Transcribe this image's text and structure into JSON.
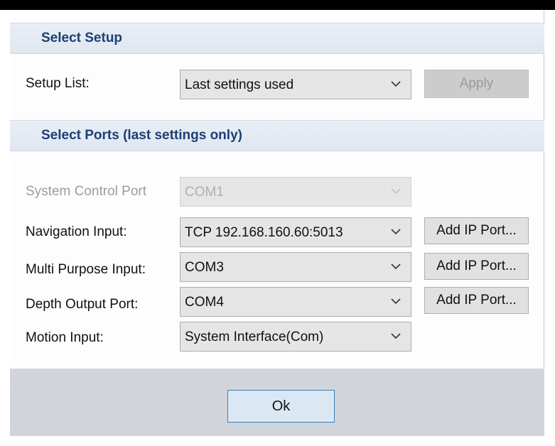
{
  "dialog": {
    "setup_section": {
      "title": "Select Setup",
      "setup_list_label": "Setup List:",
      "setup_list_value": "Last settings used",
      "apply_label": "Apply"
    },
    "ports_section": {
      "title": "Select Ports (last settings only)",
      "rows": [
        {
          "label": "System Control Port",
          "value": "COM1",
          "enabled": false,
          "add_button": null
        },
        {
          "label": "Navigation Input:",
          "value": "TCP 192.168.160.60:5013",
          "enabled": true,
          "add_button": "Add IP Port..."
        },
        {
          "label": "Multi Purpose Input:",
          "value": "COM3",
          "enabled": true,
          "add_button": "Add IP Port..."
        },
        {
          "label": "Depth Output Port:",
          "value": "COM4",
          "enabled": true,
          "add_button": "Add IP Port..."
        },
        {
          "label": "Motion Input:",
          "value": "System Interface(Com)",
          "enabled": true,
          "add_button": null
        }
      ]
    },
    "ok_label": "Ok"
  },
  "icons": {
    "dropdown": "chevron-down-icon"
  },
  "colors": {
    "section_title": "#1d3f73",
    "section_bg": "#e4ebf4",
    "footer_bg": "#d0d4db",
    "ok_border": "#3c7fb1",
    "ok_bg": "#dbe8f4"
  }
}
